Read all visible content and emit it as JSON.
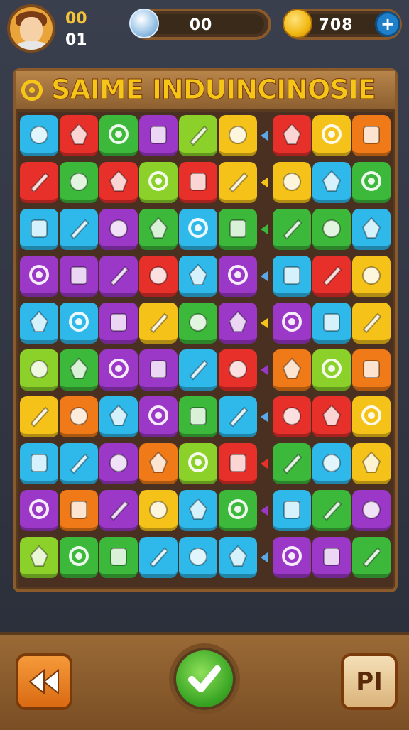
{
  "hud": {
    "avatar_icon": "player-avatar-icon",
    "level_label": "00",
    "moves_label": "01",
    "gems": {
      "icon": "gem-icon",
      "value": "00"
    },
    "coins": {
      "icon": "coin-icon",
      "value": "708",
      "plus_label": "+"
    }
  },
  "board": {
    "title": "SAIME INDUINCINOSIE",
    "title_icon": "target-icon",
    "rows": [
      [
        "#2fb8ea",
        "#e8302a",
        "#3cb83a",
        "#9b38c8",
        "#8bd12a",
        "#f5c21a",
        "#e8302a",
        "#f5c21a",
        "#f07a18"
      ],
      [
        "#e8302a",
        "#3cb83a",
        "#e8302a",
        "#8bd12a",
        "#e8302a",
        "#f5c21a",
        "#f5c21a",
        "#2fb8ea",
        "#3cb83a"
      ],
      [
        "#2fb8ea",
        "#2fb8ea",
        "#9b38c8",
        "#3cb83a",
        "#2fb8ea",
        "#3cb83a",
        "#3cb83a",
        "#3cb83a",
        "#2fb8ea"
      ],
      [
        "#9b38c8",
        "#9b38c8",
        "#9b38c8",
        "#e8302a",
        "#2fb8ea",
        "#9b38c8",
        "#2fb8ea",
        "#e8302a",
        "#f5c21a"
      ],
      [
        "#2fb8ea",
        "#2fb8ea",
        "#9b38c8",
        "#f5c21a",
        "#3cb83a",
        "#9b38c8",
        "#9b38c8",
        "#2fb8ea",
        "#f5c21a"
      ],
      [
        "#8bd12a",
        "#3cb83a",
        "#9b38c8",
        "#9b38c8",
        "#2fb8ea",
        "#e8302a",
        "#f07a18",
        "#8bd12a",
        "#f07a18"
      ],
      [
        "#f5c21a",
        "#f07a18",
        "#2fb8ea",
        "#9b38c8",
        "#3cb83a",
        "#2fb8ea",
        "#e8302a",
        "#e8302a",
        "#f5c21a"
      ],
      [
        "#2fb8ea",
        "#2fb8ea",
        "#9b38c8",
        "#f07a18",
        "#8bd12a",
        "#e8302a",
        "#3cb83a",
        "#2fb8ea",
        "#f5c21a"
      ],
      [
        "#9b38c8",
        "#f07a18",
        "#9b38c8",
        "#f5c21a",
        "#2fb8ea",
        "#3cb83a",
        "#2fb8ea",
        "#3cb83a",
        "#9b38c8"
      ],
      [
        "#8bd12a",
        "#3cb83a",
        "#3cb83a",
        "#2fb8ea",
        "#2fb8ea",
        "#2fb8ea",
        "#9b38c8",
        "#9b38c8",
        "#3cb83a"
      ]
    ]
  },
  "controls": {
    "back_icon": "rewind-icon",
    "confirm_icon": "checkmark-icon",
    "pause_label": "PI"
  },
  "colors": {
    "gold": "#f5c518",
    "wood": "#8a5a2a",
    "confirm_green": "#3aa624"
  }
}
